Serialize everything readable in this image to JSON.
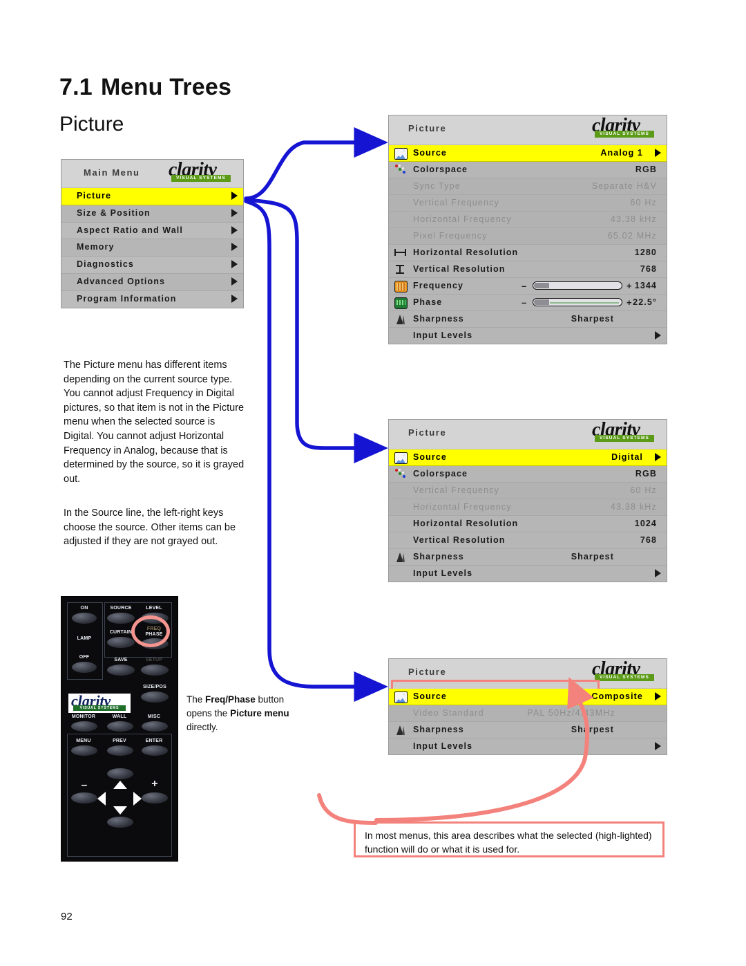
{
  "document": {
    "section_number": "7.1",
    "section_title": "Menu Trees",
    "subsection_title": "Picture",
    "page_number": "92"
  },
  "brand": {
    "logo_word": "clarity",
    "logo_tagline": "VISUAL SYSTEMS"
  },
  "main_menu": {
    "title": "Main Menu",
    "items": [
      {
        "label": "Picture",
        "highlighted": true
      },
      {
        "label": "Size & Position",
        "highlighted": false
      },
      {
        "label": "Aspect Ratio and Wall",
        "highlighted": false
      },
      {
        "label": "Memory",
        "highlighted": false
      },
      {
        "label": "Diagnostics",
        "highlighted": false
      },
      {
        "label": "Advanced Options",
        "highlighted": false
      },
      {
        "label": "Program Information",
        "highlighted": false
      }
    ]
  },
  "picture_menu_analog": {
    "title": "Picture",
    "rows": [
      {
        "icon": "source-icon",
        "label": "Source",
        "value": "Analog 1",
        "state": "highlighted",
        "caret": true
      },
      {
        "icon": "colorspace-icon",
        "label": "Colorspace",
        "value": "RGB",
        "state": "normal",
        "caret": false
      },
      {
        "icon": "none",
        "label": "Sync Type",
        "value": "Separate H&V",
        "state": "grayed",
        "caret": false
      },
      {
        "icon": "none",
        "label": "Vertical Frequency",
        "value": "60 Hz",
        "state": "grayed",
        "caret": false
      },
      {
        "icon": "none",
        "label": "Horizontal Frequency",
        "value": "43.38 kHz",
        "state": "grayed",
        "caret": false
      },
      {
        "icon": "none",
        "label": "Pixel Frequency",
        "value": "65.02 MHz",
        "state": "grayed",
        "caret": false
      },
      {
        "icon": "hres-icon",
        "label": "Horizontal Resolution",
        "value": "1280",
        "state": "normal",
        "caret": false
      },
      {
        "icon": "vres-icon",
        "label": "Vertical Resolution",
        "value": "768",
        "state": "normal",
        "caret": false
      },
      {
        "icon": "frequency-icon",
        "label": "Frequency",
        "value": "1344",
        "state": "normal",
        "caret": false,
        "slider": {
          "minus": "–",
          "plus": "+",
          "fill_pct": 18
        }
      },
      {
        "icon": "phase-icon",
        "label": "Phase",
        "value": "22.5°",
        "state": "normal",
        "caret": false,
        "slider": {
          "minus": "–",
          "plus": "+",
          "fill_pct": 18
        }
      },
      {
        "icon": "sharpness-icon",
        "label": "Sharpness",
        "value": "Sharpest",
        "state": "normal",
        "caret": false
      },
      {
        "icon": "none",
        "label": "Input Levels",
        "value": "",
        "state": "normal",
        "caret": true
      }
    ]
  },
  "picture_menu_digital": {
    "title": "Picture",
    "rows": [
      {
        "icon": "source-icon",
        "label": "Source",
        "value": "Digital",
        "state": "highlighted",
        "caret": true
      },
      {
        "icon": "colorspace-icon",
        "label": "Colorspace",
        "value": "RGB",
        "state": "normal",
        "caret": false
      },
      {
        "icon": "none",
        "label": "Vertical Frequency",
        "value": "60 Hz",
        "state": "grayed",
        "caret": false
      },
      {
        "icon": "none",
        "label": "Horizontal Frequency",
        "value": "43.38 kHz",
        "state": "grayed",
        "caret": false
      },
      {
        "icon": "none",
        "label": "Horizontal Resolution",
        "value": "1024",
        "state": "normal",
        "caret": false
      },
      {
        "icon": "none",
        "label": "Vertical Resolution",
        "value": "768",
        "state": "normal",
        "caret": false
      },
      {
        "icon": "sharpness-icon",
        "label": "Sharpness",
        "value": "Sharpest",
        "state": "normal",
        "caret": false
      },
      {
        "icon": "none",
        "label": "Input Levels",
        "value": "",
        "state": "normal",
        "caret": true
      }
    ]
  },
  "picture_menu_composite": {
    "title": "Picture",
    "description_area_text": "",
    "rows": [
      {
        "icon": "source-icon",
        "label": "Source",
        "value": "Composite",
        "state": "highlighted",
        "caret": true
      },
      {
        "icon": "none",
        "label": "Video Standard",
        "value": "PAL 50Hz/4.43MHz",
        "state": "grayed",
        "caret": false
      },
      {
        "icon": "sharpness-icon",
        "label": "Sharpness",
        "value": "Sharpest",
        "state": "normal",
        "caret": false
      },
      {
        "icon": "none",
        "label": "Input Levels",
        "value": "",
        "state": "normal",
        "caret": true
      }
    ]
  },
  "body_text": {
    "paragraph_1": "The Picture menu has different items depending on the current source type. You cannot adjust Frequency in Digital pictures, so that item is not in the Picture menu when the selected source is Digital. You cannot adjust Horizontal Frequency in Analog, because that is determined by the source, so it is grayed out.",
    "paragraph_2": "In the Source line, the left-right keys choose the source. Other items can be adjusted if they are not grayed out."
  },
  "remote_caption": {
    "line_prefix": "The ",
    "bold_1": "Freq/Phase",
    "middle": " button opens the ",
    "bold_2": "Picture menu",
    "suffix": " directly."
  },
  "callout": {
    "text": "In most menus, this area describes what the selected (high-lighted) function will do or what it is used for."
  },
  "remote": {
    "buttons": [
      "ON",
      "SOURCE",
      "LEVEL",
      "LAMP",
      "CURTAIN",
      "FREQ PHASE",
      "OFF",
      "SAVE",
      "SETUP",
      "SIZE/POS",
      "MONITOR",
      "WALL",
      "MISC",
      "MENU",
      "PREV",
      "ENTER"
    ],
    "highlighted_button": "FREQ PHASE"
  },
  "colors": {
    "highlight_yellow": "#ffff00",
    "menu_gray": "#b6b6b6",
    "header_gray": "#d4d4d4",
    "arrow_blue": "#1414d2",
    "callout_pink": "#f4827c",
    "logo_green": "#5b9b17"
  }
}
